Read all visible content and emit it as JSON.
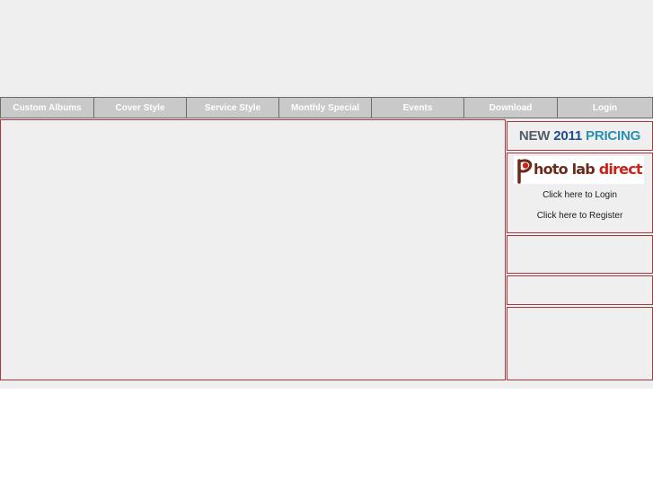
{
  "nav": {
    "items": [
      {
        "label": "Custom Albums"
      },
      {
        "label": "Cover Style"
      },
      {
        "label": "Service Style"
      },
      {
        "label": "Monthly Special"
      },
      {
        "label": "Events"
      },
      {
        "label": "Download"
      },
      {
        "label": "Login"
      }
    ]
  },
  "sidebar": {
    "pricing": {
      "part1": "NEW",
      "part2": "2011",
      "part3": "PRICING"
    },
    "logo": {
      "text_dark": "hoto lab",
      "text_red": "direct"
    },
    "login_link": "Click here to Login",
    "register_link": "Click here to Register"
  },
  "colors": {
    "border_accent": "#a9363c",
    "nav_background": "#c9c9c9",
    "page_background": "#efefef"
  }
}
